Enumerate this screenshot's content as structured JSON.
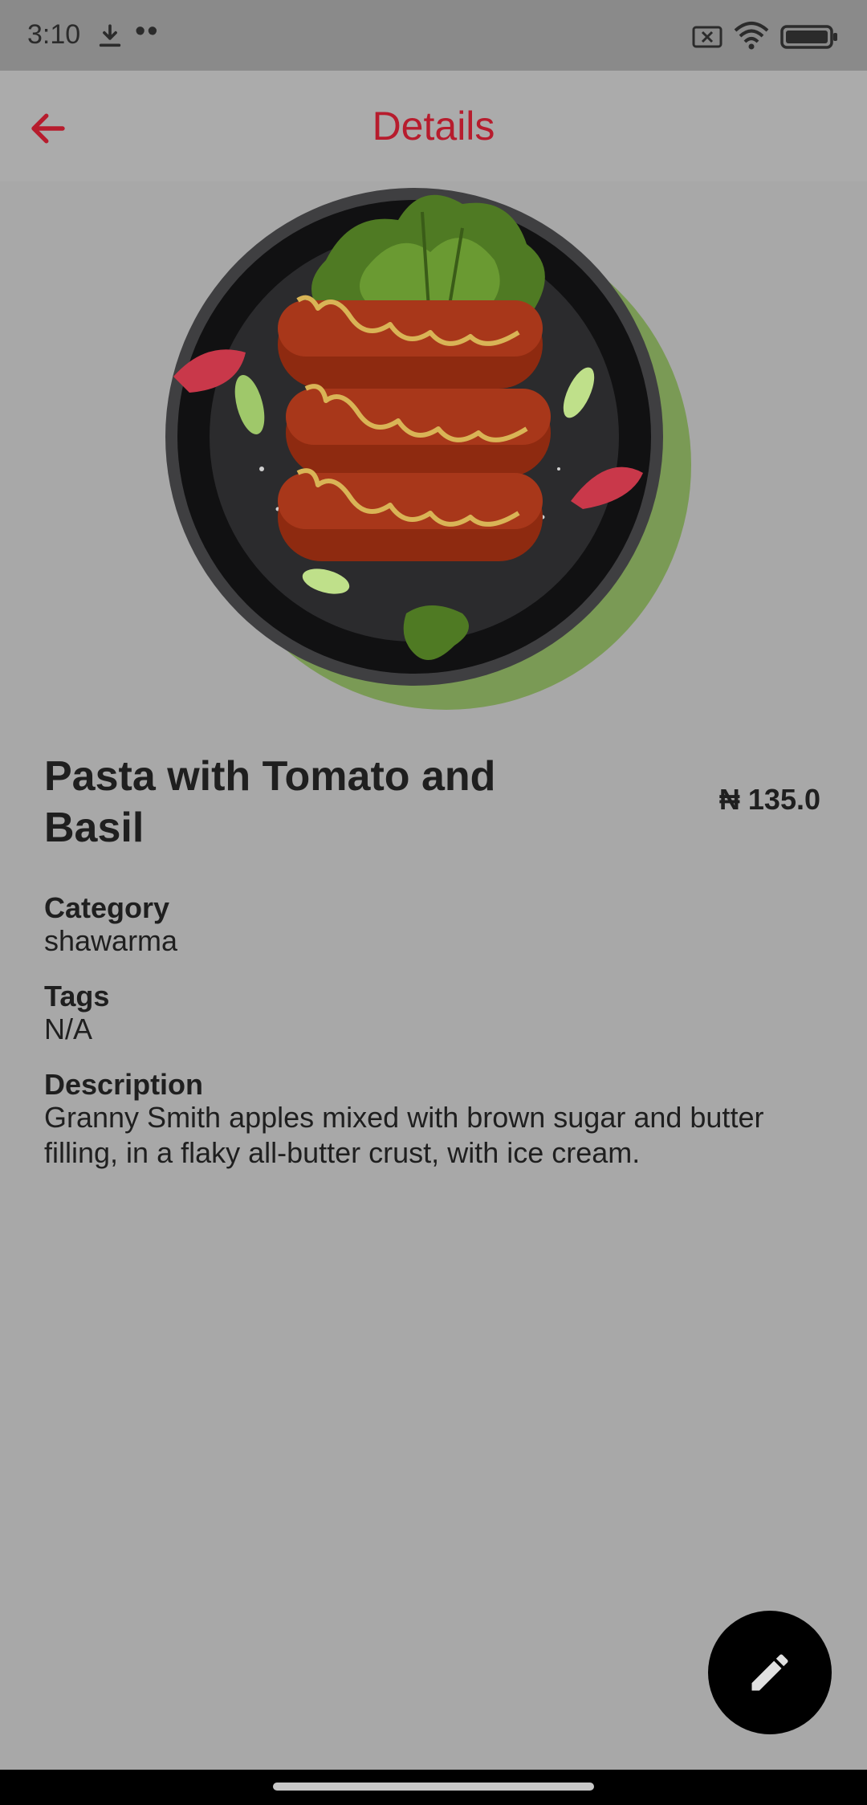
{
  "status_bar": {
    "time": "3:10",
    "dots": "••",
    "icons": [
      "download-icon",
      "no-sim-icon",
      "wifi-icon",
      "battery-icon"
    ]
  },
  "app_bar": {
    "title": "Details",
    "back_icon": "arrow-back-icon",
    "accent_color": "#b71c2d"
  },
  "item": {
    "title": "Pasta with Tomato and Basil",
    "price": "₦ 135.0",
    "category_label": "Category",
    "category_value": "shawarma",
    "tags_label": "Tags",
    "tags_value": "N/A",
    "description_label": "Description",
    "description_value": "Granny Smith apples mixed with brown sugar and butter filling, in a flaky all-butter crust, with ice cream."
  },
  "fab": {
    "icon": "edit-pencil-icon"
  }
}
